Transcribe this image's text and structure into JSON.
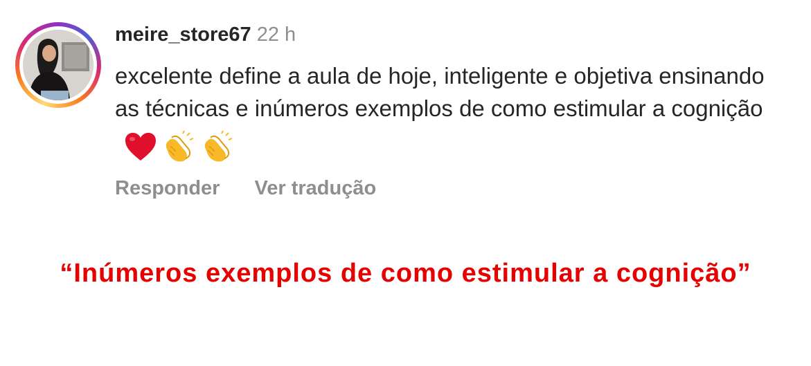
{
  "comment": {
    "username": "meire_store67",
    "timestamp": "22 h",
    "text": "excelente define a aula de hoje, inteligente e objetiva ensinando as técnicas e inúmeros exemplos de como estimular a cognição",
    "emojis": [
      "heart-emoji",
      "clapping-hands-emoji",
      "clapping-hands-emoji"
    ],
    "actions": {
      "reply_label": "Responder",
      "translate_label": "Ver tradução"
    }
  },
  "highlight_quote": "“Inúmeros exemplos de como estimular a cognição”",
  "colors": {
    "text_primary": "#262626",
    "text_secondary": "#8e8e8e",
    "quote_red": "#e60000",
    "heart_red": "#e0102d",
    "clap_yellow": "#f7b928"
  }
}
